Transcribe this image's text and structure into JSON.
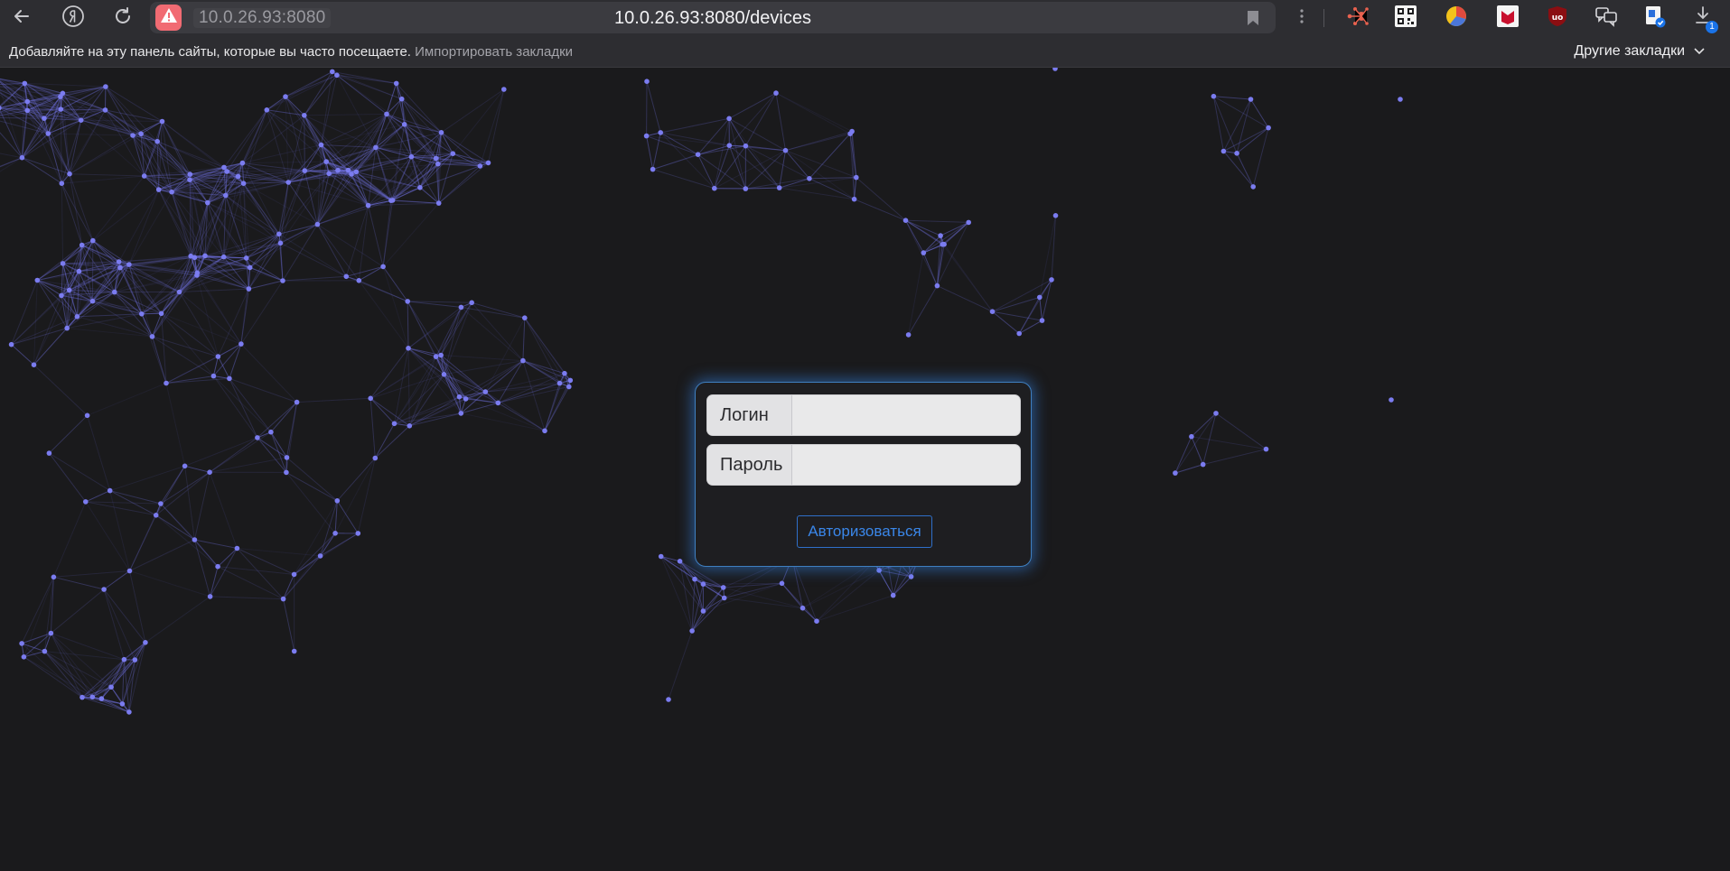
{
  "browser": {
    "address_host": "10.0.26.93:8080",
    "address_url": "10.0.26.93:8080/devices",
    "download_count": "1"
  },
  "bookmarks_bar": {
    "hint_text": "Добавляйте на эту панель сайты, которые вы часто посещаете.",
    "import_link": "Импортировать закладки",
    "other_bookmarks": "Другие закладки"
  },
  "login_form": {
    "login_label": "Логин",
    "login_value": "",
    "password_label": "Пароль",
    "password_value": "",
    "submit_label": "Авторизоваться"
  },
  "colors": {
    "background": "#1a1a1c",
    "network_node": "#7b7cf0",
    "card_glow": "#3484e6",
    "button_accent": "#3a86e8"
  }
}
